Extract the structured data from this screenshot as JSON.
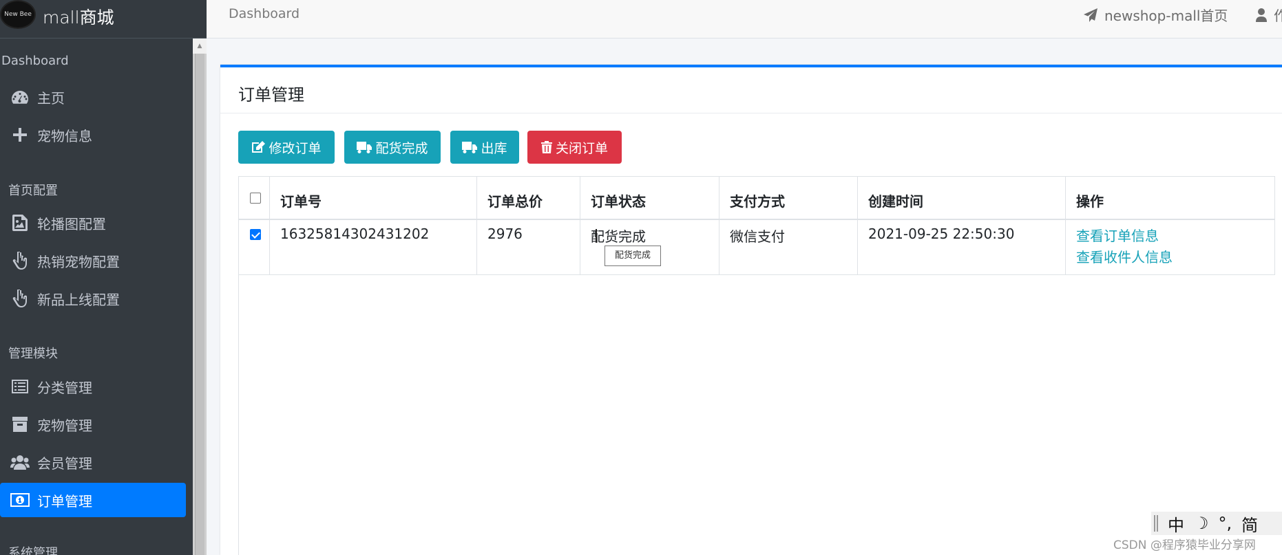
{
  "sidebar": {
    "brand_logo_text": "New Bee",
    "brand": "mall商城",
    "sections": [
      {
        "header": "Dashboard",
        "items": [
          {
            "label": "主页",
            "icon": "tachometer-icon"
          },
          {
            "label": "宠物信息",
            "icon": "plus-icon"
          }
        ]
      },
      {
        "header": "首页配置",
        "items": [
          {
            "label": "轮播图配置",
            "icon": "image-icon"
          },
          {
            "label": "热销宠物配置",
            "icon": "hand-pointer-icon"
          },
          {
            "label": "新品上线配置",
            "icon": "hand-pointer-icon"
          }
        ]
      },
      {
        "header": "管理模块",
        "items": [
          {
            "label": "分类管理",
            "icon": "list-icon"
          },
          {
            "label": "宠物管理",
            "icon": "archive-icon"
          },
          {
            "label": "会员管理",
            "icon": "users-icon"
          },
          {
            "label": "订单管理",
            "icon": "money-icon",
            "active": true
          }
        ]
      },
      {
        "header": "系统管理",
        "items": []
      }
    ]
  },
  "topbar": {
    "breadcrumb": "Dashboard",
    "home_link": "newshop-mall首页",
    "user_label": "作"
  },
  "card": {
    "title": "订单管理",
    "buttons": [
      {
        "label": "修改订单",
        "icon": "edit-icon",
        "style": "info"
      },
      {
        "label": "配货完成",
        "icon": "truck-icon",
        "style": "info"
      },
      {
        "label": "出库",
        "icon": "truck-icon",
        "style": "info"
      },
      {
        "label": "关闭订单",
        "icon": "trash-icon",
        "style": "danger"
      }
    ]
  },
  "table": {
    "columns": [
      "订单号",
      "订单总价",
      "订单状态",
      "支付方式",
      "创建时间",
      "操作"
    ],
    "rows": [
      {
        "checked": true,
        "order_no": "16325814302431202",
        "total": "2976",
        "status": "配货完成",
        "pay_method": "微信支付",
        "created": "2021-09-25 22:50:30",
        "actions": [
          "查看订单信息",
          "查看收件人信息"
        ]
      }
    ]
  },
  "tooltip": "配货完成",
  "ime": {
    "items": [
      "中",
      "☽",
      "°,",
      "简"
    ]
  },
  "watermark": "CSDN @程序猿毕业分享网",
  "colors": {
    "sidebar_bg": "#343a40",
    "active": "#007bff",
    "info": "#17a2b8",
    "danger": "#dc3545"
  }
}
